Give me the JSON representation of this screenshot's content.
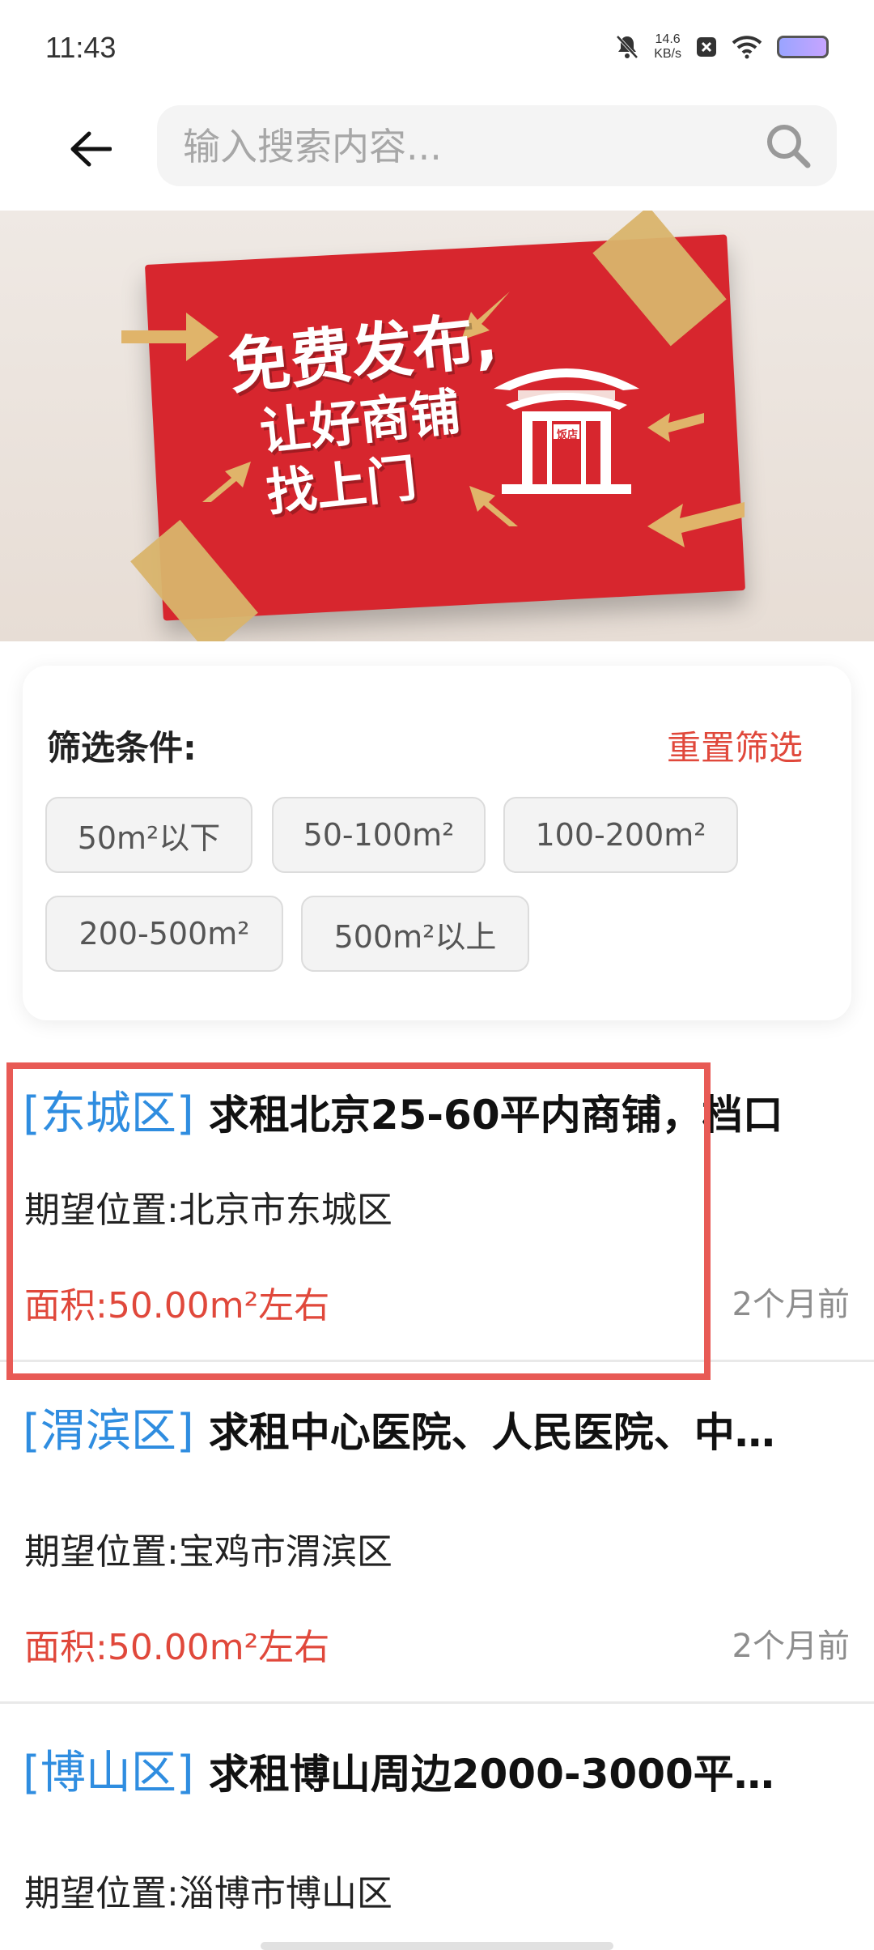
{
  "status_bar": {
    "time": "11:43",
    "net_speed_value": "14.6",
    "net_speed_unit": "KB/s",
    "icons": [
      "mute-bell-icon",
      "close-box-icon",
      "wifi-icon",
      "battery-icon"
    ]
  },
  "search": {
    "placeholder": "输入搜索内容..."
  },
  "banner": {
    "line1": "免费发布,",
    "line2": "让好商铺",
    "line3": "找上门",
    "shop_sign": "饭店"
  },
  "filters": {
    "title": "筛选条件:",
    "reset_label": "重置筛选",
    "options": [
      "50m²以下",
      "50-100m²",
      "100-200m²",
      "200-500m²",
      "500m²以上"
    ]
  },
  "listings": [
    {
      "district": "[东城区]",
      "title": "求租北京25-60平内商铺，档口",
      "location": "期望位置:北京市东城区",
      "area": "面积:50.00m²左右",
      "time": "2个月前"
    },
    {
      "district": "[渭滨区]",
      "title": "求租中心医院、人民医院、中…",
      "location": "期望位置:宝鸡市渭滨区",
      "area": "面积:50.00m²左右",
      "time": "2个月前"
    },
    {
      "district": "[博山区]",
      "title": "求租博山周边2000-3000平…",
      "location": "期望位置:淄博市博山区",
      "area": "",
      "time": ""
    }
  ],
  "colors": {
    "accent_red": "#e0483b",
    "district_blue": "#2f8de0",
    "banner_red": "#d7262e",
    "highlight": "#e85a55"
  }
}
